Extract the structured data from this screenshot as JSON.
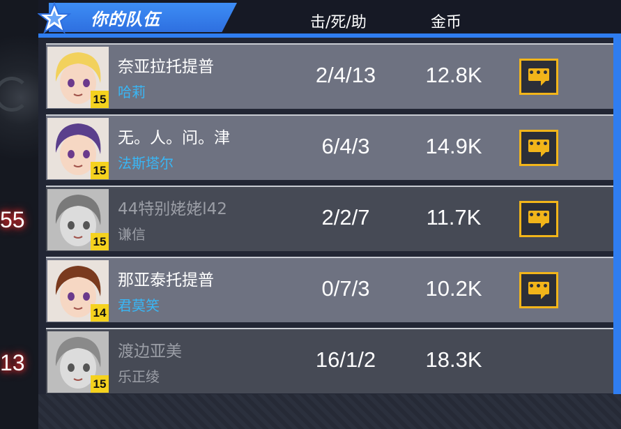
{
  "header": {
    "title": "你的队伍",
    "col_kda": "击/死/助",
    "col_gold": "金币"
  },
  "side_scores": [
    "55",
    "13"
  ],
  "players": [
    {
      "player_name": "奈亚拉托提普",
      "hero_name": "哈莉",
      "level": "15",
      "kda": "2/4/13",
      "gold": "12.8K",
      "style": "light",
      "chat": true,
      "hair": "#f2d15c",
      "grey": false
    },
    {
      "player_name": "无。人。问。津",
      "hero_name": "法斯塔尔",
      "level": "15",
      "kda": "6/4/3",
      "gold": "14.9K",
      "style": "light",
      "chat": true,
      "hair": "#5a3f8c",
      "grey": false
    },
    {
      "player_name": "44特别姥姥l42",
      "hero_name": "谦信",
      "level": "15",
      "kda": "2/2/7",
      "gold": "11.7K",
      "style": "dark",
      "chat": true,
      "hair": "#7a7a7a",
      "grey": true
    },
    {
      "player_name": "那亚泰托提普",
      "hero_name": "君莫笑",
      "level": "14",
      "kda": "0/7/3",
      "gold": "10.2K",
      "style": "light",
      "chat": true,
      "hair": "#7a3a1e",
      "grey": false
    },
    {
      "player_name": "渡边亚美",
      "hero_name": "乐正绫",
      "level": "15",
      "kda": "16/1/2",
      "gold": "18.3K",
      "style": "dark",
      "chat": false,
      "hair": "#8a8a8a",
      "grey": true
    }
  ],
  "colors": {
    "accent_blue": "#2f7df0",
    "hero_name_blue": "#39b6f5",
    "level_yellow": "#f5d21e",
    "chat_gold": "#f2b51a"
  },
  "icons": {
    "chat": "chat-bubble-icon",
    "title": "star-badge-icon"
  }
}
